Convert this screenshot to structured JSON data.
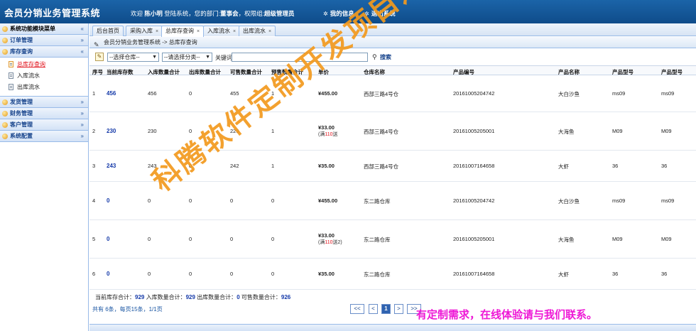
{
  "header": {
    "app_title": "会员分销业务管理系统",
    "welcome_prefix": "欢迎",
    "user_name": "陈小明",
    "welcome_mid": "登陆系统，您的部门:",
    "department": "董事会",
    "role_prefix": "，权限组:",
    "role": "超级管理员",
    "my_info": "我的信息",
    "logout": "退出系统"
  },
  "sidebar": {
    "title": "系统功能模块菜单",
    "groups": [
      {
        "label": "订单管理",
        "chev": "»"
      },
      {
        "label": "库存查询",
        "chev": "«",
        "items": [
          "总库存查询",
          "入库流水",
          "出库流水"
        ]
      },
      {
        "label": "发货管理",
        "chev": "»"
      },
      {
        "label": "财务管理",
        "chev": "»"
      },
      {
        "label": "客户管理",
        "chev": "»"
      },
      {
        "label": "系统配置",
        "chev": "»"
      }
    ]
  },
  "tabs": [
    {
      "label": "后台首页",
      "closable": false
    },
    {
      "label": "采购入库",
      "closable": true
    },
    {
      "label": "总库存查询",
      "closable": true
    },
    {
      "label": "入库流水",
      "closable": true
    },
    {
      "label": "出库流水",
      "closable": true
    }
  ],
  "breadcrumb": "会员分销业务管理系统 -> 总库存查询",
  "search": {
    "warehouse_select": "--选择仓库--",
    "category_select": "--请选择分类--",
    "keyword_label": "关键词:",
    "keyword_value": "",
    "button": "搜索"
  },
  "table": {
    "columns": [
      "序号",
      "当前库存数",
      "入库数量合计",
      "出库数量合计",
      "可售数量合计",
      "预售数量合计",
      "单价",
      "仓库名称",
      "产品编号",
      "产品名称",
      "产品型号",
      "产品型号"
    ],
    "rows": [
      {
        "no": "1",
        "stock": "456",
        "in": "456",
        "out": "0",
        "sellable": "455",
        "presale": "1",
        "price": "¥455.00",
        "price_note_pre": "",
        "price_note_red": "",
        "price_note_post": "",
        "warehouse": "西部三路4号仓",
        "code": "20161005204742",
        "name": "大白沙鱼",
        "model": "ms09",
        "model2": "ms09"
      },
      {
        "no": "2",
        "stock": "230",
        "in": "230",
        "out": "0",
        "sellable": "229",
        "presale": "1",
        "price": "¥33.00",
        "price_note_pre": "(满",
        "price_note_red": "110",
        "price_note_post": "送",
        "warehouse": "西部三路4号仓",
        "code": "20161005205001",
        "name": "大海鱼",
        "model": "M09",
        "model2": "M09"
      },
      {
        "no": "3",
        "stock": "243",
        "in": "243",
        "out": "0",
        "sellable": "242",
        "presale": "1",
        "price": "¥35.00",
        "price_note_pre": "",
        "price_note_red": "",
        "price_note_post": "",
        "warehouse": "西部三路4号仓",
        "code": "20161007164658",
        "name": "大虾",
        "model": "36",
        "model2": "36"
      },
      {
        "no": "4",
        "stock": "0",
        "in": "0",
        "out": "0",
        "sellable": "0",
        "presale": "0",
        "price": "¥455.00",
        "price_note_pre": "",
        "price_note_red": "",
        "price_note_post": "",
        "warehouse": "东二路仓库",
        "code": "20161005204742",
        "name": "大白沙鱼",
        "model": "ms09",
        "model2": "ms09"
      },
      {
        "no": "5",
        "stock": "0",
        "in": "0",
        "out": "0",
        "sellable": "0",
        "presale": "0",
        "price": "¥33.00",
        "price_note_pre": "(满",
        "price_note_red": "110",
        "price_note_post": "送2)",
        "warehouse": "东二路仓库",
        "code": "20161005205001",
        "name": "大海鱼",
        "model": "M09",
        "model2": "M09"
      },
      {
        "no": "6",
        "stock": "0",
        "in": "0",
        "out": "0",
        "sellable": "0",
        "presale": "0",
        "price": "¥35.00",
        "price_note_pre": "",
        "price_note_red": "",
        "price_note_post": "",
        "warehouse": "东二路仓库",
        "code": "20161007164658",
        "name": "大虾",
        "model": "36",
        "model2": "36"
      }
    ]
  },
  "totals": {
    "stock_label": "当前库存合计：",
    "stock_value": "929",
    "in_label": "入库数量合计：",
    "in_value": "929",
    "out_label": "出库数量合计：",
    "out_value": "0",
    "sell_label": "可售数量合计：",
    "sell_value": "926"
  },
  "pagination": {
    "info": "共有 6条，每页15条，1/1页",
    "first": "<<",
    "prev": "<",
    "current": "1",
    "next": ">",
    "last": ">>"
  },
  "watermark": {
    "diagonal": "科腾软件定制开发项目之一",
    "contact": "有定制需求，在线体验请与我们联系。"
  },
  "colors": {
    "header_blue": "#1b64a8",
    "link_blue": "#1338a8",
    "active_red": "#e1121b",
    "watermark_orange": "#f39a1e",
    "watermark_magenta": "#ee18d6"
  }
}
